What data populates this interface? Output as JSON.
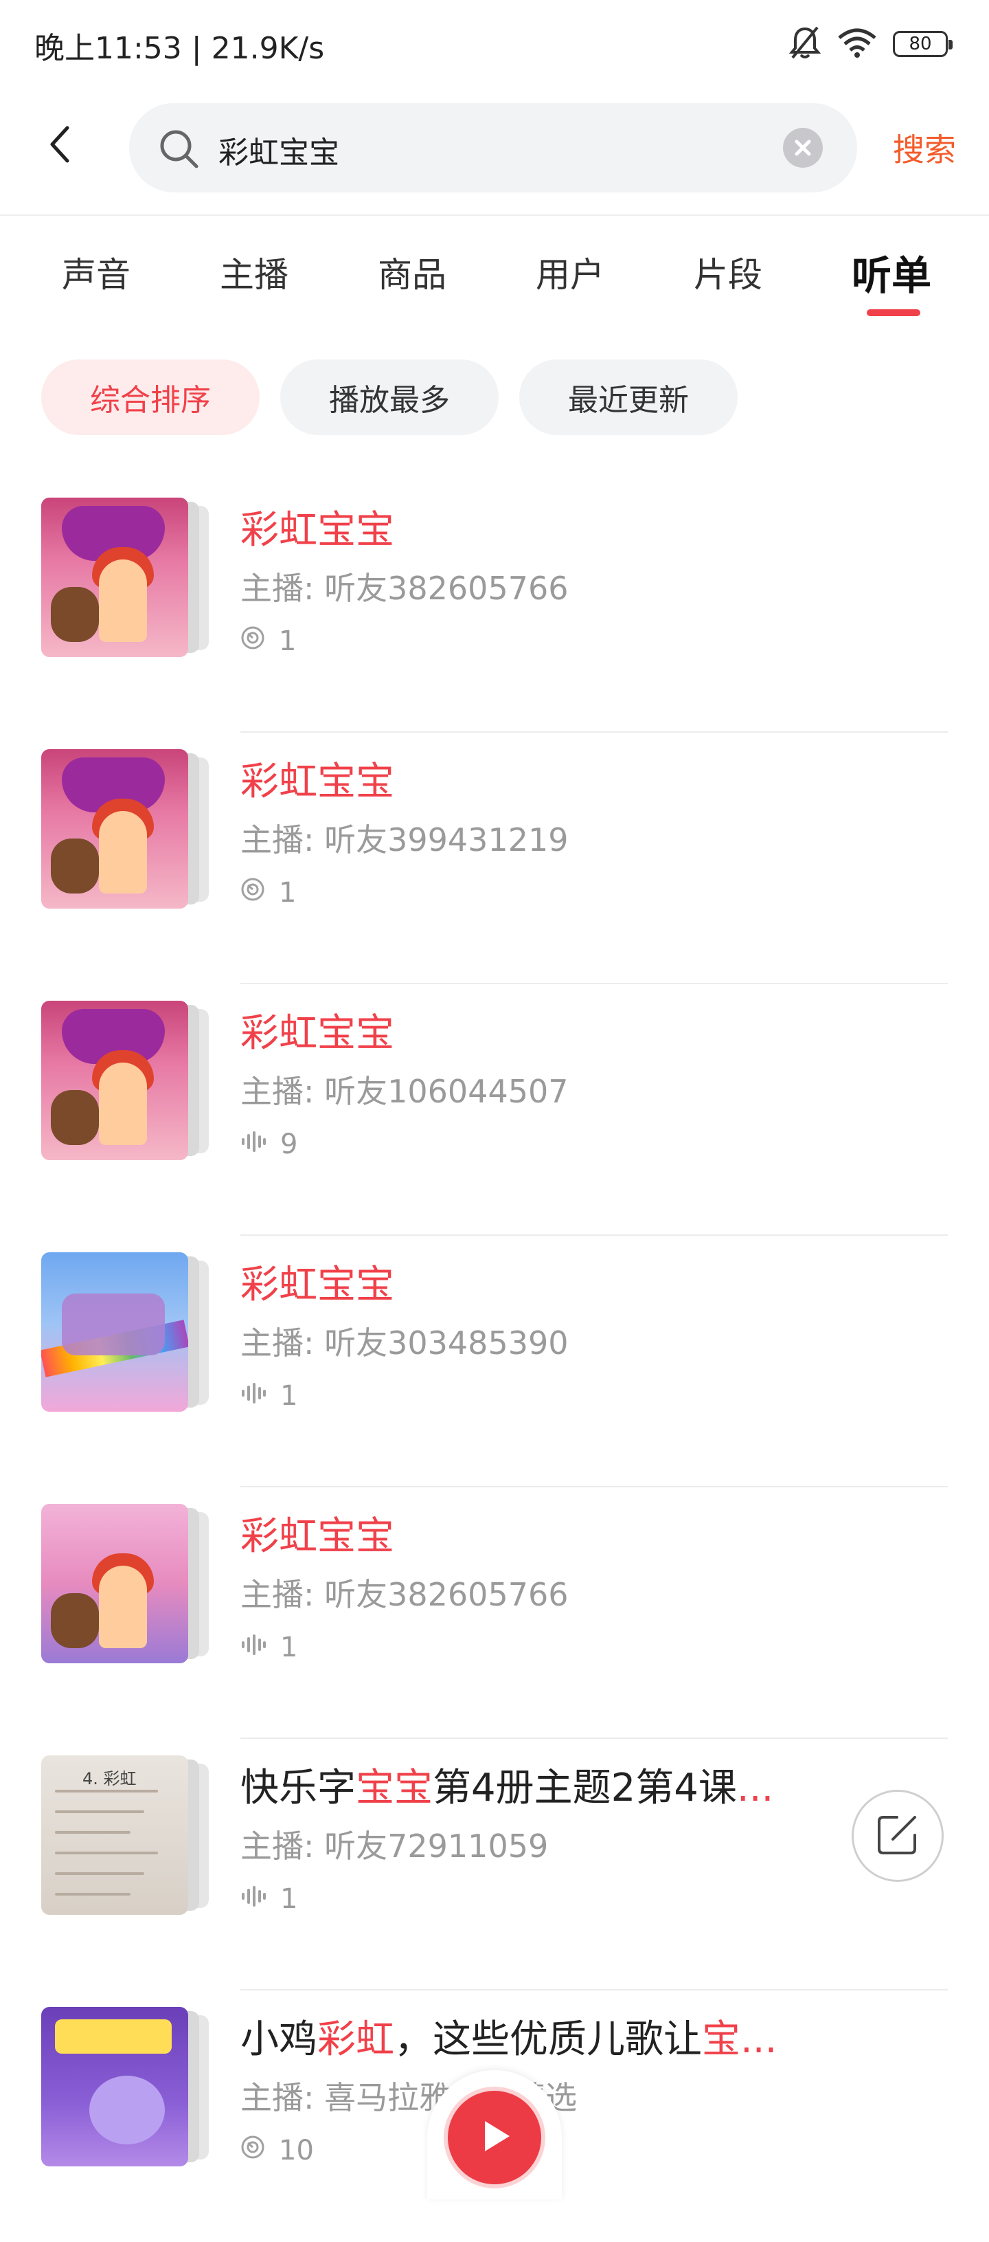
{
  "status_bar": {
    "time": "晚上11:53 | 21.9K/s",
    "battery": "80",
    "icons": [
      "bell-mute-icon",
      "wifi-icon",
      "battery-icon"
    ]
  },
  "search": {
    "query": "彩虹宝宝",
    "submit_label": "搜索",
    "accent": "#f35b2a"
  },
  "tabs": [
    {
      "label": "声音",
      "active": false
    },
    {
      "label": "主播",
      "active": false
    },
    {
      "label": "商品",
      "active": false
    },
    {
      "label": "用户",
      "active": false
    },
    {
      "label": "片段",
      "active": false
    },
    {
      "label": "听单",
      "active": true
    }
  ],
  "sort_options": [
    {
      "label": "综合排序",
      "active": true
    },
    {
      "label": "播放最多",
      "active": false
    },
    {
      "label": "最近更新",
      "active": false
    }
  ],
  "results": [
    {
      "title_parts": [
        {
          "text": "彩虹宝宝",
          "hl": true
        }
      ],
      "anchor": "主播: 听友382605766",
      "meta_icon": "playlist-icon",
      "count": "1",
      "cover": "c-pink"
    },
    {
      "title_parts": [
        {
          "text": "彩虹宝宝",
          "hl": true
        }
      ],
      "anchor": "主播: 听友399431219",
      "meta_icon": "playlist-icon",
      "count": "1",
      "cover": "c-pink"
    },
    {
      "title_parts": [
        {
          "text": "彩虹宝宝",
          "hl": true
        }
      ],
      "anchor": "主播: 听友106044507",
      "meta_icon": "audio-wave-icon",
      "count": "9",
      "cover": "c-pink"
    },
    {
      "title_parts": [
        {
          "text": "彩虹宝宝",
          "hl": true
        }
      ],
      "anchor": "主播: 听友303485390",
      "meta_icon": "audio-wave-icon",
      "count": "1",
      "cover": "c-sky"
    },
    {
      "title_parts": [
        {
          "text": "彩虹宝宝",
          "hl": true
        }
      ],
      "anchor": "主播: 听友382605766",
      "meta_icon": "audio-wave-icon",
      "count": "1",
      "cover": "c-candy"
    },
    {
      "title_parts": [
        {
          "text": "快乐字",
          "hl": false
        },
        {
          "text": "宝宝",
          "hl": true
        },
        {
          "text": "第4册主题2第4课",
          "hl": false
        },
        {
          "text": "...",
          "hl": true
        }
      ],
      "anchor": "主播: 听友72911059",
      "meta_icon": "audio-wave-icon",
      "count": "1",
      "cover": "c-book",
      "cover_text": "4. 彩虹"
    },
    {
      "title_parts": [
        {
          "text": "小鸡",
          "hl": false
        },
        {
          "text": "彩虹",
          "hl": true
        },
        {
          "text": "，这些优质儿歌让",
          "hl": false
        },
        {
          "text": "宝...",
          "hl": true
        }
      ],
      "anchor": "主播: 喜马拉雅儿童精选",
      "meta_icon": "playlist-icon",
      "count": "10",
      "cover": "c-purple"
    }
  ],
  "colors": {
    "highlight": "#f0414a",
    "secondary_text": "#9a9a9a",
    "play_button": "#ec3b44"
  }
}
